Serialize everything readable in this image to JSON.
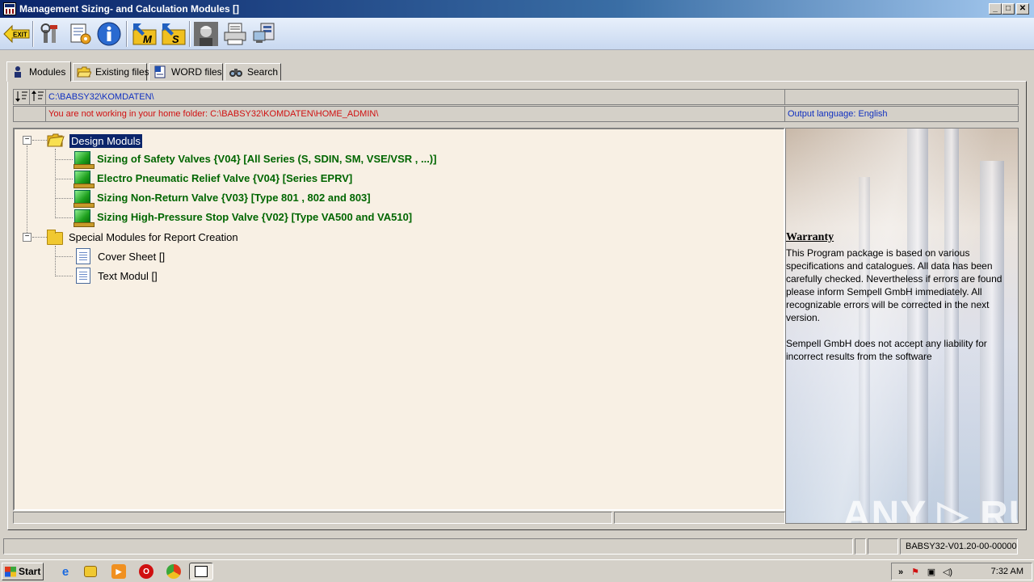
{
  "window": {
    "title": "Management Sizing- and Calculation Modules []",
    "min_label": "_",
    "max_label": "□",
    "close_label": "✕"
  },
  "toolbar": {
    "exit_label": "EXIT",
    "m_label": "M",
    "s_label": "S"
  },
  "tabs": [
    {
      "label": "Modules",
      "active": true
    },
    {
      "label": "Existing files"
    },
    {
      "label": "WORD files"
    },
    {
      "label": "Search"
    }
  ],
  "path": {
    "current_folder": "C:\\BABSY32\\KOMDATEN\\",
    "warning": "You are not working in your home folder: C:\\BABSY32\\KOMDATEN\\HOME_ADMIN\\",
    "output_language": "Output language: English"
  },
  "tree": {
    "groups": [
      {
        "label": "Design Moduls",
        "expander": "−",
        "items": [
          "Sizing of Safety Valves {V04} [All Series (S, SDIN, SM, VSE/VSR , ...)]",
          "Electro Pneumatic Relief Valve {V04} [Series EPRV]",
          "Sizing Non-Return Valve {V03} [Type 801 , 802 and 803]",
          "Sizing High-Pressure Stop Valve {V02} [Type VA500 and VA510]"
        ]
      },
      {
        "label": "Special Modules for Report Creation",
        "expander": "−",
        "items": [
          "Cover Sheet []",
          "Text Modul []"
        ]
      }
    ]
  },
  "warranty": {
    "title": "Warranty",
    "text": "This Program package is based on various specifications and catalogues. All data has been carefully checked. Nevertheless if errors are found please inform Sempell GmbH immediately. All recognizable errors will be corrected in the next version.",
    "text2": "Sempell GmbH does not accept any liability for incorrect results from the software"
  },
  "watermark": "ANY ▷ RUN",
  "status": {
    "version": "BABSY32-V01.20-00-00000"
  },
  "taskbar": {
    "start_label": "Start",
    "clock": "7:32 AM",
    "tray_arrow": "»"
  }
}
